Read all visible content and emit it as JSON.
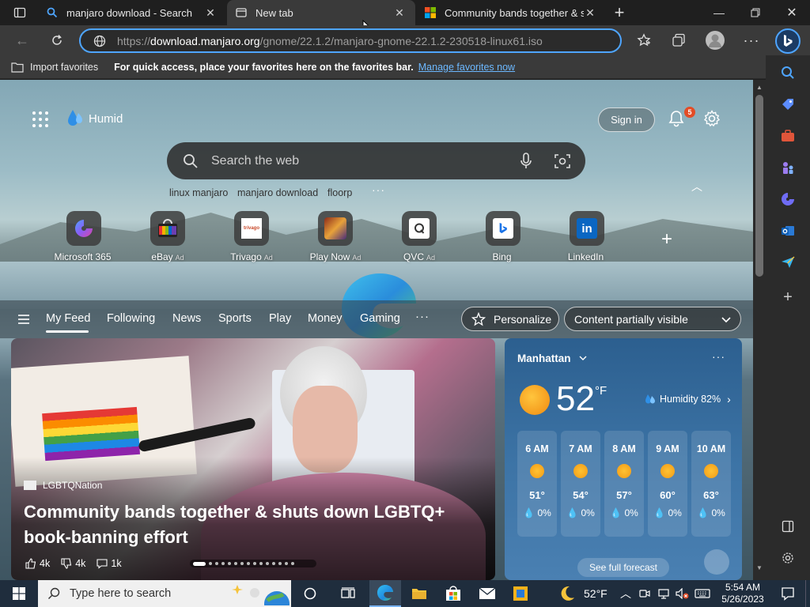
{
  "tabs": [
    {
      "label": "manjaro download - Search",
      "icon": "search-icon"
    },
    {
      "label": "New tab",
      "icon": "newtab-icon"
    },
    {
      "label": "Community bands together & shuts",
      "icon": "msn-logo-icon"
    }
  ],
  "address": {
    "url_prefix": "https://",
    "url_domain": "download.manjaro.org",
    "url_path": "/gnome/22.1.2/manjaro-gnome-22.1.2-230518-linux61.iso"
  },
  "favorites_bar": {
    "import_label": "Import favorites",
    "hint": "For quick access, place your favorites here on the favorites bar.",
    "manage_link": "Manage favorites now"
  },
  "page": {
    "brand": "Humid",
    "sign_in": "Sign in",
    "notifications_count": "5",
    "search_placeholder": "Search the web",
    "quick_searches": [
      "linux manjaro",
      "manjaro download",
      "floorp"
    ]
  },
  "tiles": [
    {
      "label": "Microsoft 365",
      "ad": ""
    },
    {
      "label": "eBay",
      "ad": "Ad"
    },
    {
      "label": "Trivago",
      "ad": "Ad"
    },
    {
      "label": "Play Now",
      "ad": "Ad"
    },
    {
      "label": "QVC",
      "ad": "Ad"
    },
    {
      "label": "Bing",
      "ad": ""
    },
    {
      "label": "LinkedIn",
      "ad": ""
    }
  ],
  "feed_nav": {
    "items": [
      "My Feed",
      "Following",
      "News",
      "Sports",
      "Play",
      "Money",
      "Gaming"
    ],
    "personalize": "Personalize",
    "content_visibility": "Content partially visible"
  },
  "news": {
    "source": "LGBTQNation",
    "headline": "Community bands together & shuts down LGBTQ+ book-banning effort",
    "likes": "4k",
    "dislikes": "4k",
    "comments": "1k"
  },
  "weather": {
    "location": "Manhattan",
    "temp": "52",
    "unit": "°F",
    "humidity": "Humidity 82%",
    "hours": [
      {
        "time": "6 AM",
        "temp": "51°",
        "precip": "0%"
      },
      {
        "time": "7 AM",
        "temp": "54°",
        "precip": "0%"
      },
      {
        "time": "8 AM",
        "temp": "57°",
        "precip": "0%"
      },
      {
        "time": "9 AM",
        "temp": "60°",
        "precip": "0%"
      },
      {
        "time": "10 AM",
        "temp": "63°",
        "precip": "0%"
      }
    ],
    "forecast_link": "See full forecast"
  },
  "taskbar": {
    "search_placeholder": "Type here to search",
    "weather_temp": "52°F",
    "time": "5:54 AM",
    "date": "5/26/2023"
  },
  "colors": {
    "accent": "#4ea5ff",
    "link": "#6cb8ff",
    "taskbar": "#1f2d3d"
  }
}
